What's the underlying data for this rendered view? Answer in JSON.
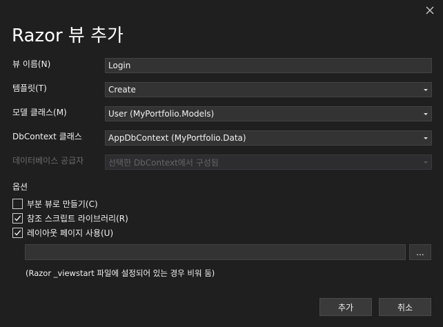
{
  "dialog": {
    "title": "Razor 뷰 추가",
    "close_icon": "close-icon"
  },
  "fields": {
    "view_name": {
      "label": "뷰 이름(N)",
      "value": "Login"
    },
    "template": {
      "label": "템플릿(T)",
      "value": "Create"
    },
    "model_class": {
      "label": "모델 클래스(M)",
      "value": "User (MyPortfolio.Models)"
    },
    "dbcontext_class": {
      "label": "DbContext 클래스",
      "value": "AppDbContext (MyPortfolio.Data)"
    },
    "db_provider": {
      "label": "데이터베이스 공급자",
      "value": "선택한 DbContext에서 구성됨",
      "disabled": true
    }
  },
  "options": {
    "header": "옵션",
    "partial_view": {
      "label": "부분 뷰로 만들기(C)",
      "checked": false
    },
    "reference_scripts": {
      "label": "참조 스크립트 라이브러리(R)",
      "checked": true
    },
    "use_layout": {
      "label": "레이아웃 페이지 사용(U)",
      "checked": true
    },
    "layout_path": {
      "value": ""
    },
    "browse_label": "...",
    "hint": "(Razor _viewstart 파일에 설정되어 있는 경우 비워 둠)"
  },
  "buttons": {
    "add": "추가",
    "cancel": "취소"
  }
}
